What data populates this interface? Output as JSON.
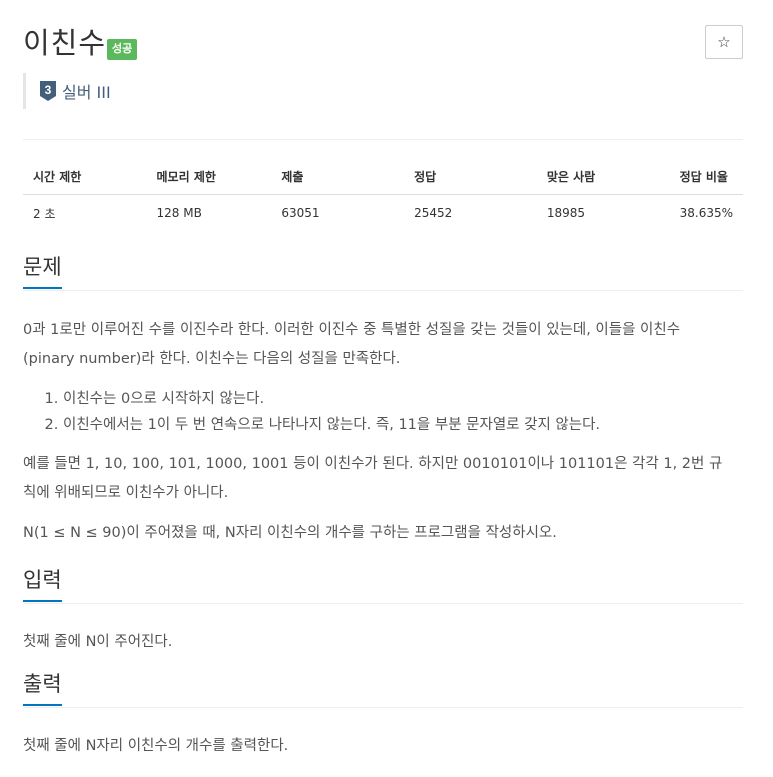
{
  "problem": {
    "title": "이친수",
    "status_badge": "성공",
    "star_glyph": "☆",
    "tier_number": "3",
    "tier_label": "실버 III"
  },
  "info_table": {
    "headers": [
      "시간 제한",
      "메모리 제한",
      "제출",
      "정답",
      "맞은 사람",
      "정답 비율"
    ],
    "values": [
      "2 초",
      "128 MB",
      "63051",
      "25452",
      "18985",
      "38.635%"
    ]
  },
  "sections": {
    "description": {
      "heading": "문제",
      "para1_line1": "0과 1로만 이루어진 수를 이진수라 한다. 이러한 이진수 중 특별한 성질을 갖는 것들이 있는데, 이들을 이친수",
      "para1_line2": "(pinary number)라 한다. 이친수는 다음의 성질을 만족한다.",
      "conditions": [
        "이친수는 0으로 시작하지 않는다.",
        "이친수에서는 1이 두 번 연속으로 나타나지 않는다. 즉, 11을 부분 문자열로 갖지 않는다."
      ],
      "para2_line1": "예를 들면 1, 10, 100, 101, 1000, 1001 등이 이친수가 된다. 하지만 0010101이나 101101은 각각 1, 2번 규",
      "para2_line2": "칙에 위배되므로 이친수가 아니다.",
      "para3": "N(1 ≤ N ≤ 90)이 주어졌을 때, N자리 이친수의 개수를 구하는 프로그램을 작성하시오."
    },
    "input": {
      "heading": "입력",
      "text": "첫째 줄에 N이 주어진다."
    },
    "output": {
      "heading": "출력",
      "text": "첫째 줄에 N자리 이친수의 개수를 출력한다."
    }
  },
  "colors": {
    "success_badge": "#5cb85c",
    "heading_underline": "#0076c0",
    "tier_silver": "#435f7a"
  },
  "icons": {
    "star": "star-icon",
    "tier": "tier-badge-icon"
  }
}
